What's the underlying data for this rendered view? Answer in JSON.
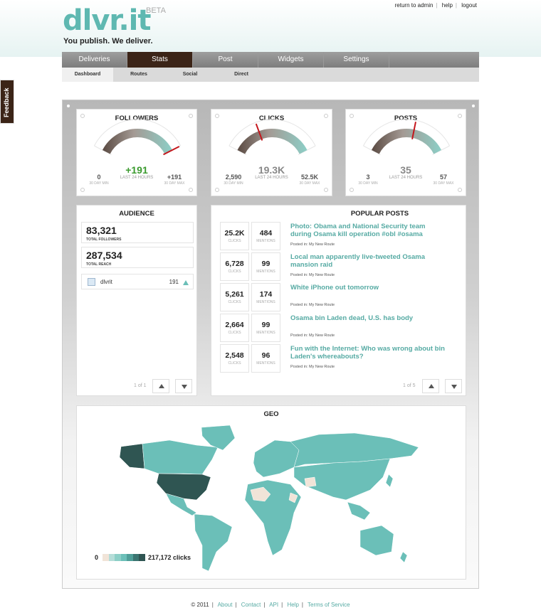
{
  "header": {
    "logo": "dlvr.it",
    "beta": "BETA",
    "tagline": "You publish. We deliver.",
    "links": [
      "return to admin",
      "help",
      "logout"
    ]
  },
  "feedback": "Feedback",
  "nav": {
    "tabs": [
      {
        "label": "Deliveries",
        "active": false
      },
      {
        "label": "Stats",
        "active": true
      },
      {
        "label": "Post",
        "active": false
      },
      {
        "label": "Widgets",
        "active": false
      },
      {
        "label": "Settings",
        "active": false
      }
    ],
    "subtabs": [
      {
        "label": "Dashboard",
        "active": true
      },
      {
        "label": "Routes",
        "active": false
      },
      {
        "label": "Social",
        "active": false
      },
      {
        "label": "Direct",
        "active": false
      }
    ]
  },
  "gauges": [
    {
      "title": "FOLLOWERS",
      "value": "+191",
      "value_color": "#3a9a2e",
      "sub": "LAST 24 HOURS",
      "min": "0",
      "min_label": "30 DAY MIN",
      "max": "+191",
      "max_label": "30 DAY MAX",
      "fraction": 1.0
    },
    {
      "title": "CLICKS",
      "value": "19.3K",
      "value_color": "#888888",
      "sub": "LAST 24 HOURS",
      "min": "2,590",
      "min_label": "30 DAY MIN",
      "max": "52.5K",
      "max_label": "30 DAY MAX",
      "fraction": 0.34
    },
    {
      "title": "POSTS",
      "value": "35",
      "value_color": "#888888",
      "sub": "LAST 24 HOURS",
      "min": "3",
      "min_label": "30 DAY MIN",
      "max": "57",
      "max_label": "30 DAY MAX",
      "fraction": 0.59
    }
  ],
  "audience": {
    "title": "AUDIENCE",
    "total_followers": "83,321",
    "total_followers_label": "TOTAL FOLLOWERS",
    "total_reach": "287,534",
    "total_reach_label": "TOTAL REACH",
    "account": {
      "name": "dlvrit",
      "count": "191"
    },
    "pager": "1 of 1"
  },
  "popular_posts": {
    "title": "POPULAR POSTS",
    "pager": "1 of 5",
    "posts": [
      {
        "clicks": "25.2K",
        "mentions": "484",
        "title": "Photo: Obama and National Security team during Osama kill operation #obl #osama",
        "meta": "Posted in: My New Route"
      },
      {
        "clicks": "6,728",
        "mentions": "99",
        "title": "Local man apparently live-tweeted Osama mansion raid",
        "meta": "Posted in: My New Route"
      },
      {
        "clicks": "5,261",
        "mentions": "174",
        "title": "White iPhone out tomorrow",
        "meta": "Posted in: My New Route"
      },
      {
        "clicks": "2,664",
        "mentions": "99",
        "title": "Osama bin Laden dead, U.S. has body",
        "meta": "Posted in: My New Route"
      },
      {
        "clicks": "2,548",
        "mentions": "96",
        "title": "Fun with the Internet: Who was wrong about bin Laden's whereabouts?",
        "meta": "Posted in: My New Route"
      }
    ],
    "clicks_label": "CLICKS",
    "mentions_label": "MENTIONS"
  },
  "geo": {
    "title": "GEO",
    "legend_min": "0",
    "legend_max": "217,172 clicks",
    "colors": [
      "#f1e4d8",
      "#b5ddd8",
      "#8ccfc7",
      "#6bbfb8",
      "#4f9e98",
      "#3b7571",
      "#2f5552"
    ]
  },
  "footer": {
    "copyright": "© 2011",
    "links": [
      "About",
      "Contact",
      "API",
      "Help",
      "Terms of Service"
    ]
  }
}
